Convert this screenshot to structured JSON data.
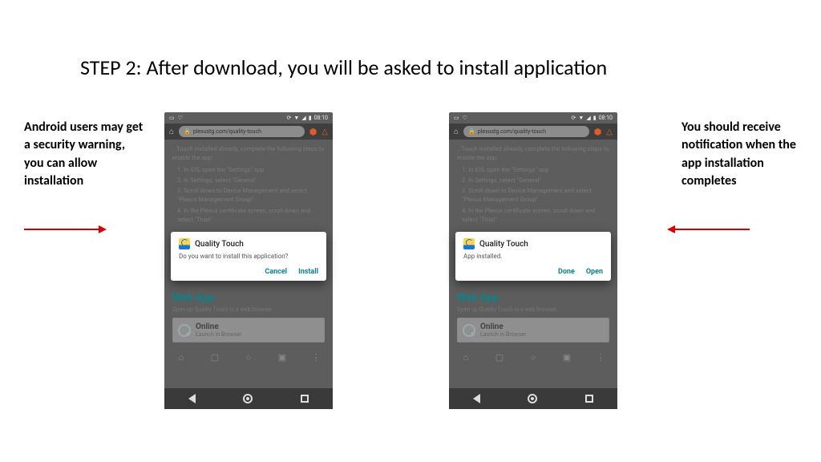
{
  "title": "STEP 2: After download, you will be asked to install application",
  "caption_left": "Android users may get a security warning, you can allow installation",
  "caption_right": "You should receive notification when the app installation completes",
  "status": {
    "time": "08:10"
  },
  "url": "plexustg.com/quality-touch",
  "page": {
    "lead": "…Touch installed already, complete the following steps to enable the app:",
    "steps": [
      "In iOS, open the \"Settings\" app",
      "In Settings, select \"General\"",
      "Scroll down to Device Management and select \"Plexus Management Group\"",
      "In the Plexus certificate screen, scroll down and select \"Trust\""
    ]
  },
  "dialog1": {
    "title": "Quality Touch",
    "message": "Do you want to install this application?",
    "cancel": "Cancel",
    "install": "Install"
  },
  "dialog2": {
    "title": "Quality Touch",
    "message": "App installed.",
    "done": "Done",
    "open": "Open"
  },
  "webapp": {
    "heading": "Web App",
    "sub": "Open up Quality Touch in a web browser.",
    "online": "Online",
    "launch": "Launch in Browser"
  }
}
